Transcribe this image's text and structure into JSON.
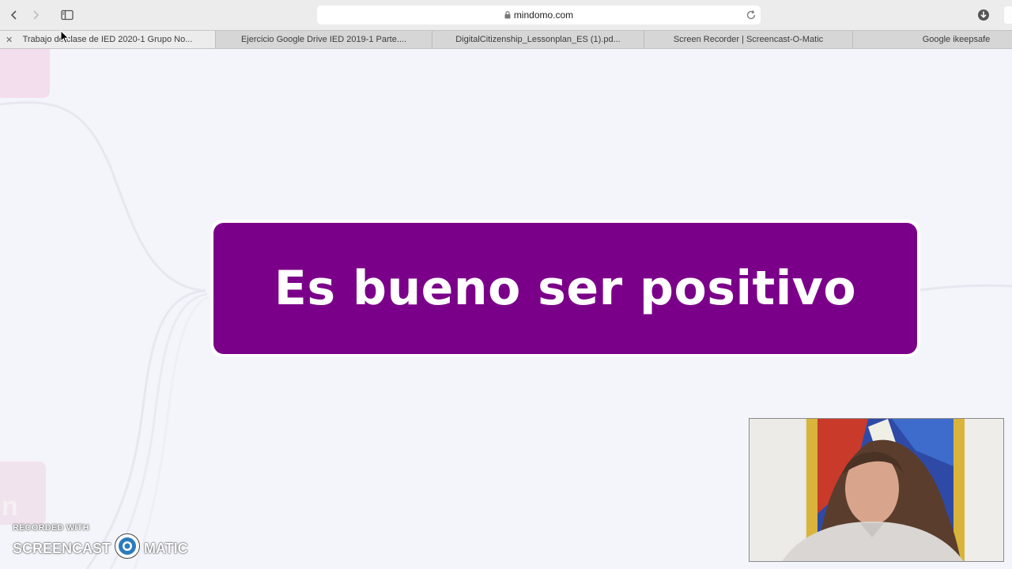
{
  "browser": {
    "address": "mindomo.com",
    "tabs": [
      {
        "label": "Trabajo de clase de IED 2020-1 Grupo No...",
        "active": true
      },
      {
        "label": "Ejercicio Google Drive IED 2019-1 Parte....",
        "active": false
      },
      {
        "label": "DigitalCitizenship_Lessonplan_ES (1).pd...",
        "active": false
      },
      {
        "label": "Screen Recorder | Screencast-O-Matic",
        "active": false
      },
      {
        "label": "Google ikeepsafe",
        "active": false
      }
    ],
    "close_glyph": "✕"
  },
  "mindmap": {
    "central_topic": "Es bueno ser positivo",
    "node_color": "#7b0089",
    "ghost_text": "n"
  },
  "watermark": {
    "recorded_with": "RECORDED WITH",
    "brand_left": "SCREENCAST",
    "brand_right": "MATIC"
  },
  "colors": {
    "canvas_bg": "#f4f5fb",
    "toolbar_bg": "#ececec",
    "tabbar_bg": "#d6d6d6"
  }
}
